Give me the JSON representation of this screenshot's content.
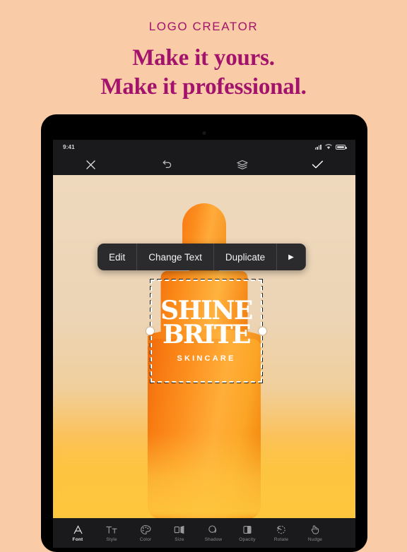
{
  "promo": {
    "eyebrow": "LOGO CREATOR",
    "headline_line1": "Make it yours.",
    "headline_line2": "Make it professional.",
    "accent_color": "#a3136b",
    "background_color": "#f9cba7"
  },
  "device": {
    "status_bar": {
      "time": "9:41",
      "icons": [
        "cellular-signal-icon",
        "wifi-icon",
        "battery-icon"
      ]
    }
  },
  "editor": {
    "top_bar": [
      {
        "name": "close-button",
        "icon": "close-icon"
      },
      {
        "name": "undo-button",
        "icon": "undo-icon"
      },
      {
        "name": "layers-button",
        "icon": "layers-icon"
      },
      {
        "name": "confirm-button",
        "icon": "checkmark-icon"
      }
    ],
    "context_menu": {
      "items": [
        {
          "label": "Edit",
          "name": "menu-item-edit"
        },
        {
          "label": "Change Text",
          "name": "menu-item-change-text"
        },
        {
          "label": "Duplicate",
          "name": "menu-item-duplicate"
        }
      ],
      "more_glyph": "▶"
    },
    "logo_object": {
      "line1": "SHINE",
      "line2": "BRITE",
      "subtitle": "SKINCARE",
      "selected": true,
      "text_color": "#ffffff"
    },
    "tool_strip": [
      {
        "label": "Font",
        "name": "tool-font",
        "icon": "font-icon",
        "active": true
      },
      {
        "label": "Style",
        "name": "tool-style",
        "icon": "text-style-icon",
        "active": false
      },
      {
        "label": "Color",
        "name": "tool-color",
        "icon": "color-palette-icon",
        "active": false
      },
      {
        "label": "Size",
        "name": "tool-size",
        "icon": "size-icon",
        "active": false
      },
      {
        "label": "Shadow",
        "name": "tool-shadow",
        "icon": "shadow-icon",
        "active": false
      },
      {
        "label": "Opacity",
        "name": "tool-opacity",
        "icon": "opacity-icon",
        "active": false
      },
      {
        "label": "Rotate",
        "name": "tool-rotate",
        "icon": "rotate-icon",
        "active": false
      },
      {
        "label": "Nudge",
        "name": "tool-nudge",
        "icon": "nudge-icon",
        "active": false
      }
    ]
  }
}
